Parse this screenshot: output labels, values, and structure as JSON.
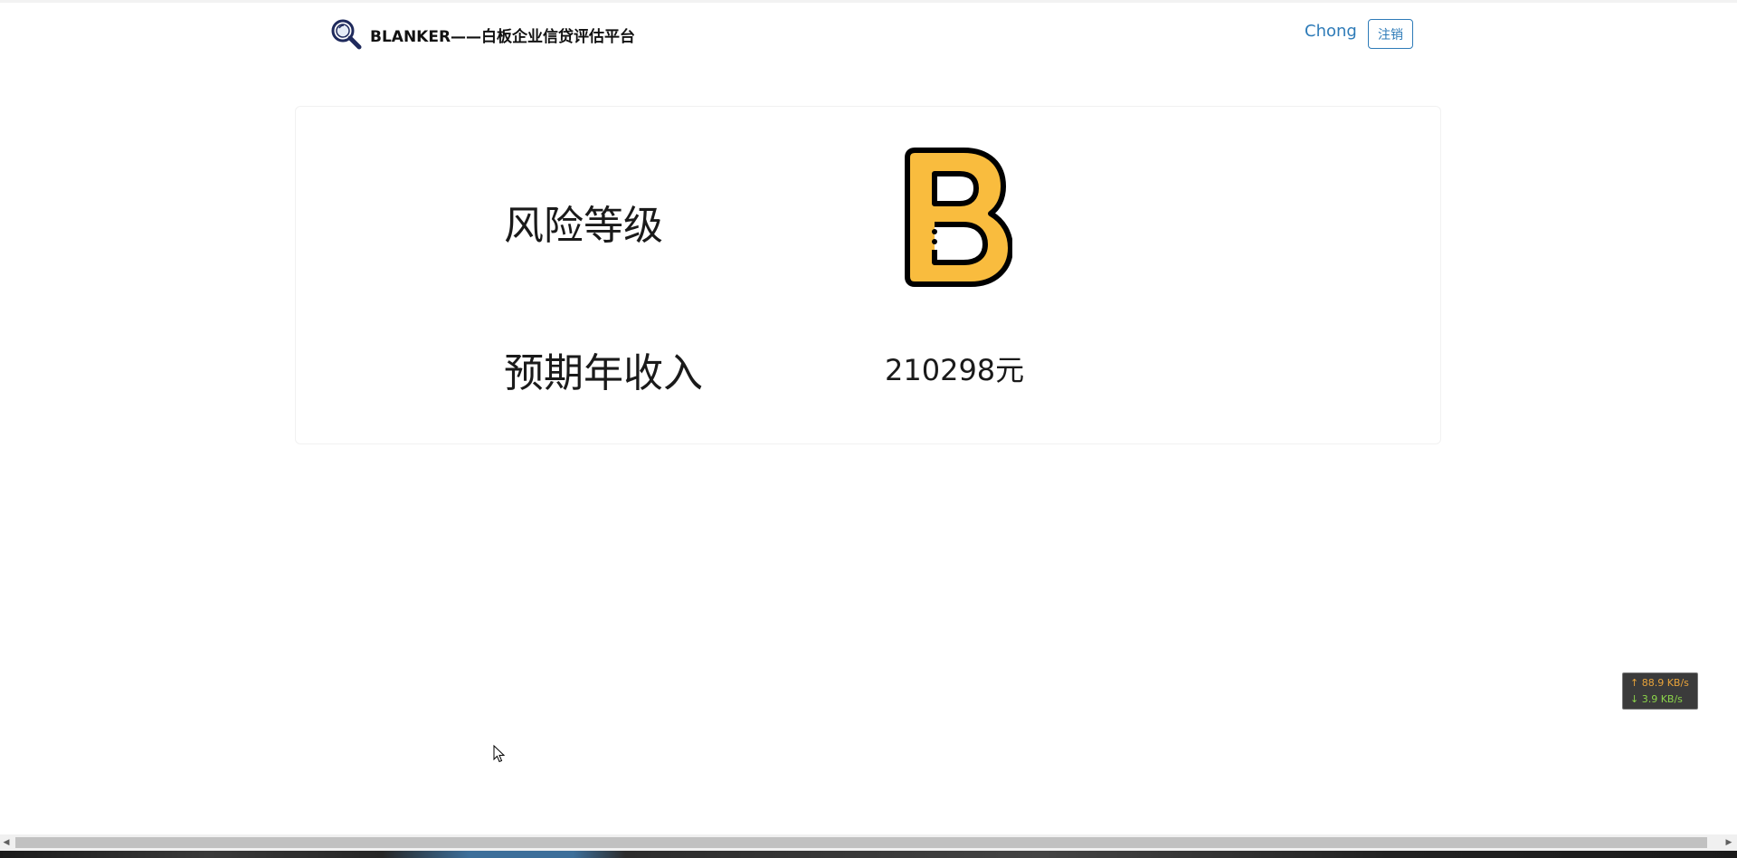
{
  "navbar": {
    "brand_text": "BLANKER——白板企业信贷评估平台",
    "user_name": "Chong",
    "logout_label": "注销"
  },
  "result": {
    "risk_label": "风险等级",
    "risk_grade": "B",
    "grade_color": "#F9BC3E",
    "income_label": "预期年收入",
    "income_value": "210298元"
  },
  "net_widget": {
    "upload": "↑ 88.9 KB/s",
    "download": "↓ 3.9 KB/s",
    "upload_color": "#E8A33A",
    "download_color": "#8BD44A"
  },
  "icons": {
    "brand": "magnifier-icon",
    "grade": "letter-b-icon",
    "cursor": "mouse-pointer-icon"
  }
}
